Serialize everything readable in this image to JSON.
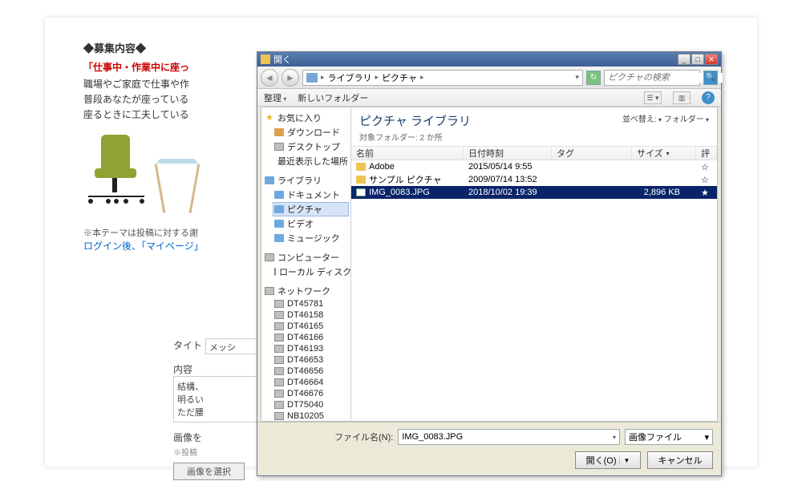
{
  "webpage": {
    "section_title": "◆募集内容◆",
    "headline": "「仕事中・作業中に座っ",
    "body1": "職場やご家庭で仕事や作",
    "body2": "普段あなたが座っている",
    "body3": "座るときに工夫している",
    "note": "※本テーマは投稿に対する謝",
    "login": "ログイン後、「マイページ」",
    "form_title": "タイト",
    "form_msg": "メッシ",
    "form_content": "内容",
    "content1": "結構、",
    "content2": "明るい",
    "content3": "ただ腰",
    "img_label": "画像を",
    "img_note": "※投稿",
    "select_btn": "画像を選択"
  },
  "dialog": {
    "title": "開く",
    "breadcrumb": {
      "root": "ライブラリ",
      "current": "ピクチャ"
    },
    "search_placeholder": "ピクチャの検索",
    "toolbar": {
      "organize": "整理",
      "newfolder": "新しいフォルダー"
    },
    "lib_title": "ピクチャ ライブラリ",
    "lib_sub": "対象フォルダー: 2 か所",
    "arrange_label": "並べ替え:",
    "arrange_value": "フォルダー",
    "columns": {
      "name": "名前",
      "date": "日付時刻",
      "tag": "タグ",
      "size": "サイズ",
      "rate": "評"
    },
    "rows": [
      {
        "type": "folder",
        "name": "Adobe",
        "date": "2015/05/14 9:55",
        "size": ""
      },
      {
        "type": "folder",
        "name": "サンプル ピクチャ",
        "date": "2009/07/14 13:52",
        "size": ""
      },
      {
        "type": "file",
        "name": "IMG_0083.JPG",
        "date": "2018/10/02 19:39",
        "size": "2,896 KB",
        "selected": true
      }
    ],
    "filename_label": "ファイル名(N):",
    "filename_value": "IMG_0083.JPG",
    "filter": "画像ファイル",
    "open_btn": "開く(O)",
    "cancel_btn": "キャンセル",
    "tree": {
      "favorites": {
        "label": "お気に入り",
        "items": [
          "ダウンロード",
          "デスクトップ",
          "最近表示した場所"
        ]
      },
      "libraries": {
        "label": "ライブラリ",
        "items": [
          "ドキュメント",
          "ピクチャ",
          "ビデオ",
          "ミュージック"
        ],
        "selected": "ピクチャ"
      },
      "computer": {
        "label": "コンピューター",
        "items": [
          "ローカル ディスク (C:)"
        ]
      },
      "network": {
        "label": "ネットワーク",
        "items": [
          "DT45781",
          "DT46158",
          "DT46165",
          "DT46166",
          "DT46193",
          "DT46653",
          "DT46656",
          "DT46664",
          "DT46676",
          "DT75040",
          "NB10205"
        ]
      }
    }
  }
}
